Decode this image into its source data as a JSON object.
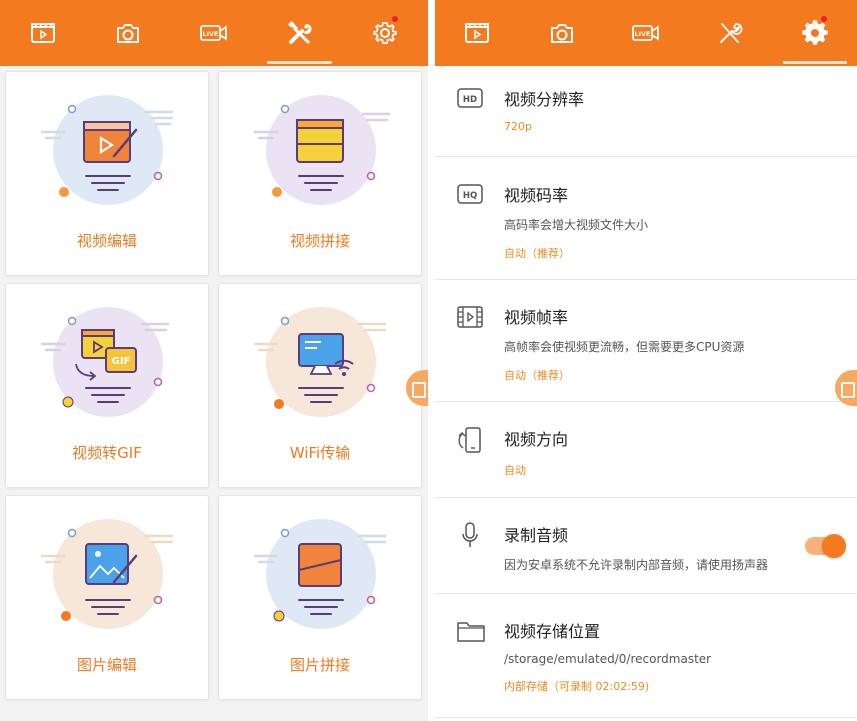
{
  "left_nav": {
    "tabs": [
      {
        "icon": "video-clapper-icon",
        "active": false
      },
      {
        "icon": "camera-icon",
        "active": false
      },
      {
        "icon": "live-icon",
        "active": false,
        "text": "LIVE"
      },
      {
        "icon": "tools-icon",
        "active": true
      },
      {
        "icon": "settings-gear-icon",
        "active": false,
        "notification_dot": true
      }
    ]
  },
  "tools": [
    {
      "label": "视频编辑",
      "icon": "video-edit-icon"
    },
    {
      "label": "视频拼接",
      "icon": "video-merge-icon"
    },
    {
      "label": "视频转GIF",
      "icon": "video-to-gif-icon"
    },
    {
      "label": "WiFi传输",
      "icon": "wifi-transfer-icon"
    },
    {
      "label": "图片编辑",
      "icon": "image-edit-icon"
    },
    {
      "label": "图片拼接",
      "icon": "image-merge-icon"
    }
  ],
  "gif_badge": "GIF",
  "live_badge": "LIVE",
  "settings": {
    "resolution": {
      "title": "视频分辨率",
      "value": "720p",
      "icon_text": "HD"
    },
    "bitrate": {
      "title": "视频码率",
      "subtitle": "高码率会增大视频文件大小",
      "value": "自动（推荐）",
      "icon_text": "HQ"
    },
    "framerate": {
      "title": "视频帧率",
      "subtitle": "高帧率会使视频更流畅，但需要更多CPU资源",
      "value": "自动（推荐）"
    },
    "orientation": {
      "title": "视频方向",
      "value": "自动"
    },
    "audio": {
      "title": "录制音频",
      "subtitle": "因为安卓系统不允许录制内部音频，请使用扬声器",
      "enabled": true
    },
    "storage": {
      "title": "视频存储位置",
      "subtitle": "/storage/emulated/0/recordmaster",
      "value": "内部存储（可录制 02:02:59)"
    }
  },
  "colors": {
    "accent": "#f47a20",
    "accent_text": "#f08a1e"
  }
}
